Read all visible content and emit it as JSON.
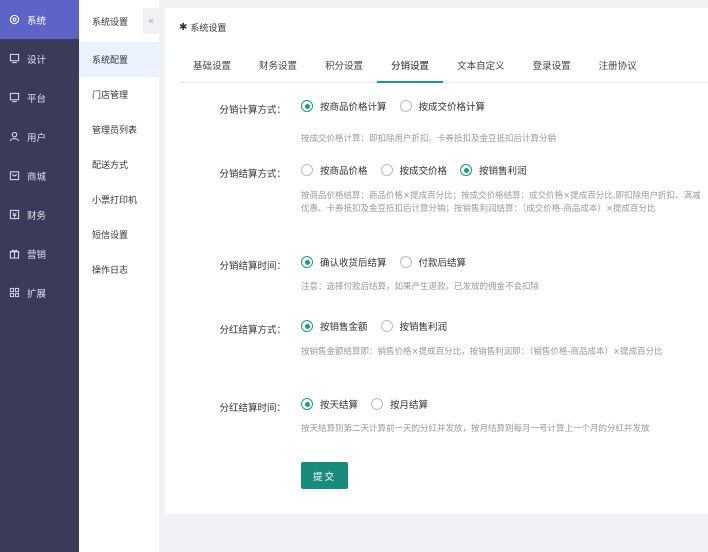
{
  "nav": {
    "items": [
      {
        "icon": "gear-icon",
        "label": "系统"
      },
      {
        "icon": "monitor-icon",
        "label": "设计"
      },
      {
        "icon": "monitor-icon",
        "label": "平台"
      },
      {
        "icon": "user-icon",
        "label": "用户"
      },
      {
        "icon": "shop-icon",
        "label": "商城"
      },
      {
        "icon": "finance-icon",
        "label": "财务"
      },
      {
        "icon": "gift-icon",
        "label": "营销"
      },
      {
        "icon": "grid-icon",
        "label": "扩展"
      }
    ]
  },
  "subnav": {
    "title": "系统设置",
    "collapse": "«",
    "items": [
      "系统配置",
      "门店管理",
      "管理员列表",
      "配送方式",
      "小票打印机",
      "短信设置",
      "操作日志"
    ]
  },
  "panel": {
    "title": "系统设置",
    "tabs": [
      "基础设置",
      "财务设置",
      "积分设置",
      "分销设置",
      "文本自定义",
      "登录设置",
      "注册协议"
    ]
  },
  "form": {
    "calc_method": {
      "label": "分销计算方式：",
      "options": [
        "按商品价格计算",
        "按成交价格计算"
      ],
      "hint": "按成交价格计算：即扣除用户折扣、卡券抵扣及金豆抵扣后计算分销"
    },
    "settle_method": {
      "label": "分销结算方式：",
      "options": [
        "按商品价格",
        "按成交价格",
        "按销售利润"
      ],
      "hint": "按商品价格结算：商品价格×提成百分比；按成交价格结算：成交价格×提成百分比,即扣除用户折扣、满减优惠、卡券抵扣及金豆抵扣后计算分销；按销售利润结算：（成交价格-商品成本）×提成百分比"
    },
    "settle_time": {
      "label": "分销结算时间：",
      "options": [
        "确认收货后结算",
        "付款后结算"
      ],
      "hint": "注意：选择付款后结算，如果产生退款，已发放的佣金不会扣除"
    },
    "bonus_method": {
      "label": "分红结算方式：",
      "options": [
        "按销售金额",
        "按销售利润"
      ],
      "hint": "按销售金额结算即：销售价格×提成百分比，按销售利润即：（销售价格-商品成本）×提成百分比"
    },
    "bonus_time": {
      "label": "分红结算时间：",
      "options": [
        "按天结算",
        "按月结算"
      ],
      "hint": "按天结算则第二天计算前一天的分红并发放，按月结算则每月一号计算上一个月的分红并发放"
    },
    "submit": "提交"
  }
}
